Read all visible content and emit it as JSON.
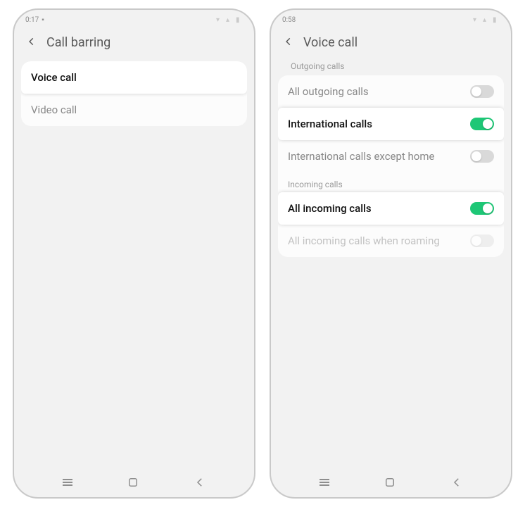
{
  "left": {
    "status_time": "0:17",
    "header_title": "Call barring",
    "items": [
      {
        "label": "Voice call",
        "highlight": true
      },
      {
        "label": "Video call",
        "highlight": false
      }
    ]
  },
  "right": {
    "status_time": "0:58",
    "header_title": "Voice call",
    "section_outgoing": "Outgoing calls",
    "section_incoming": "Incoming calls",
    "outgoing": [
      {
        "label": "All outgoing calls",
        "on": false,
        "highlight": false,
        "disabled": false
      },
      {
        "label": "International calls",
        "on": true,
        "highlight": true,
        "disabled": false
      },
      {
        "label": "International calls except home",
        "on": false,
        "highlight": false,
        "disabled": false
      }
    ],
    "incoming": [
      {
        "label": "All incoming calls",
        "on": true,
        "highlight": true,
        "disabled": false
      },
      {
        "label": "All incoming calls when roaming",
        "on": false,
        "highlight": false,
        "disabled": true
      }
    ]
  }
}
